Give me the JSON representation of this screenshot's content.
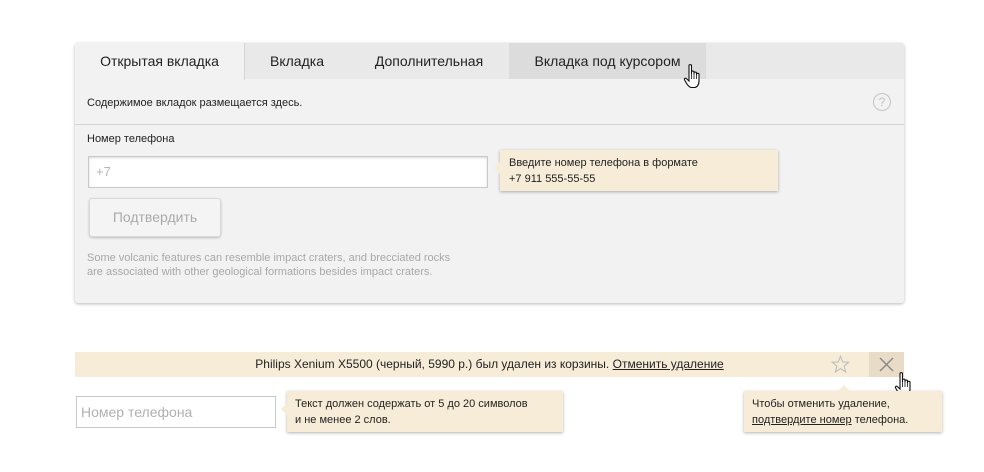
{
  "tabs": {
    "items": [
      {
        "label": "Открытая вкладка",
        "state": "active"
      },
      {
        "label": "Вкладка",
        "state": "normal"
      },
      {
        "label": "Дополнительная",
        "state": "normal"
      },
      {
        "label": "Вкладка под курсором",
        "state": "hover"
      }
    ],
    "content_text": "Содержимое вкладок размещается здесь.",
    "help_symbol": "?"
  },
  "form": {
    "phone_label": "Номер телефона",
    "phone_value": "+7",
    "tooltip_line1": "Введите номер телефона в формате",
    "tooltip_line2": "+7 911 555-55-55",
    "confirm_label": "Подтвердить",
    "note_text": "Some volcanic features can resemble impact craters, and brecciated rocks are associated with other geological formations besides impact craters."
  },
  "notification": {
    "message": "Philips Xenium X5500 (черный, 5990 р.) был удален из корзины.",
    "undo_link": "Отменить удаление",
    "icons": [
      "star-icon",
      "close-icon"
    ]
  },
  "close_tooltip": {
    "line1": "Чтобы отменить удаление,",
    "link_text": "подтвердите номер",
    "line2_rest": " телефона."
  },
  "bottom_field": {
    "placeholder": "Номер телефона",
    "tooltip_line1": "Текст должен содержать от 5 до 20 символов",
    "tooltip_line2": "и не менее 2 слов."
  },
  "colors": {
    "panel_bg": "#f2f2f2",
    "tab_hover_bg": "#dcdcdc",
    "tooltip_bg": "#f7ecd8",
    "muted_text": "#a8a8a8"
  }
}
